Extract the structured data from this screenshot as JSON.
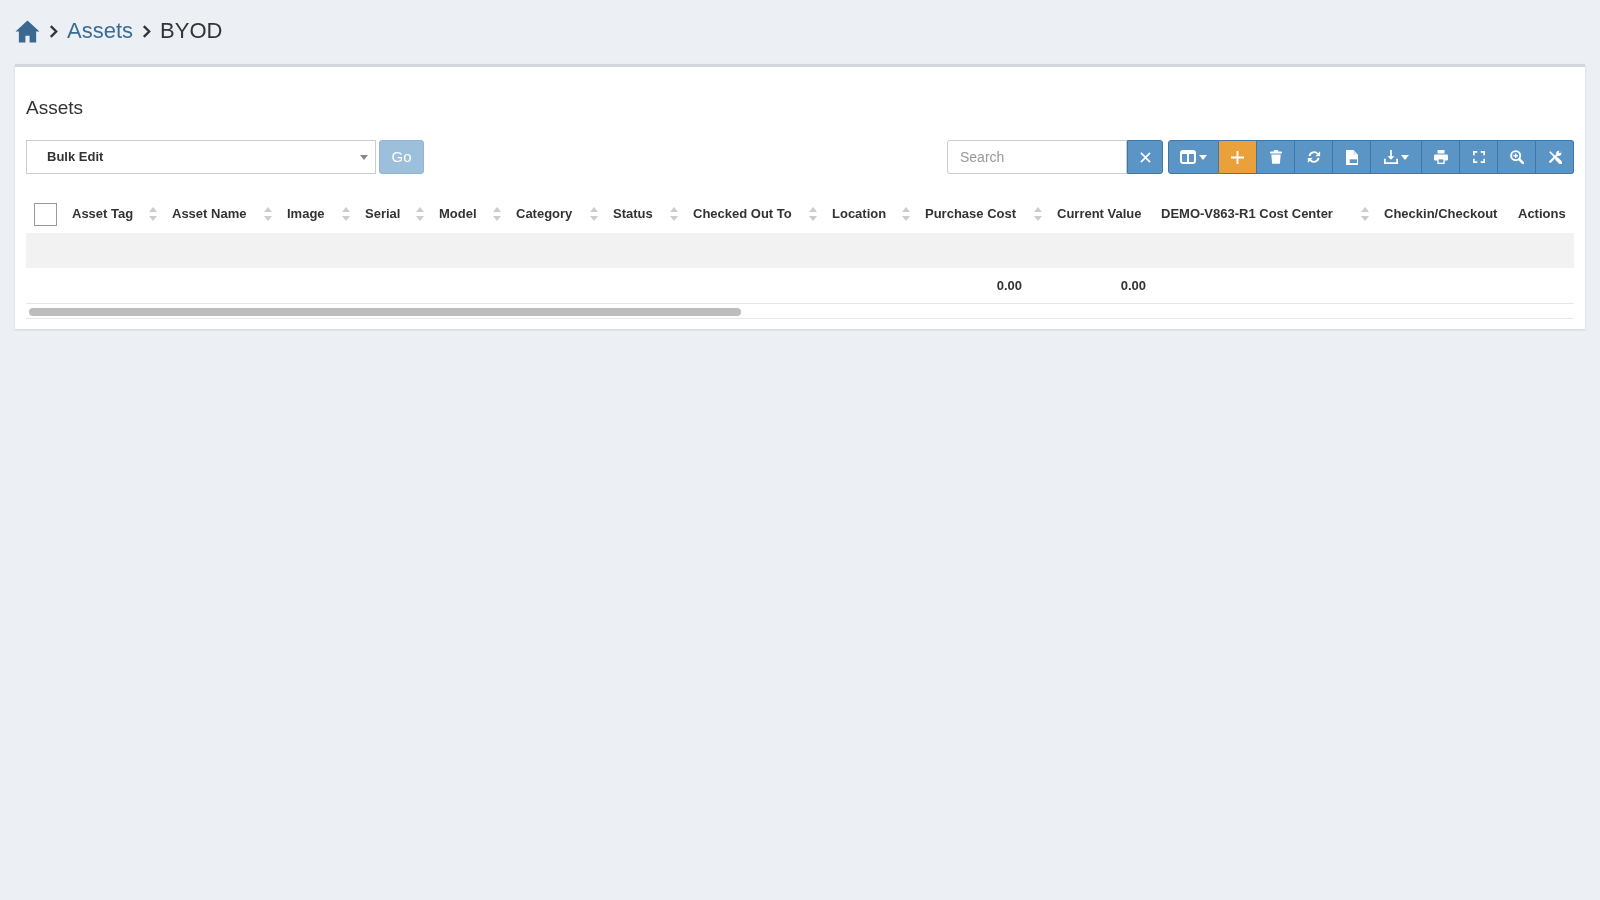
{
  "breadcrumb": [
    {
      "kind": "home"
    },
    {
      "kind": "link",
      "text": "Assets"
    },
    {
      "kind": "current",
      "text": "BYOD"
    }
  ],
  "panel": {
    "title": "Assets"
  },
  "bulk_actions": {
    "value": "Bulk Edit",
    "go_button": {
      "label": "Go",
      "disabled": true
    }
  },
  "search": {
    "placeholder": "Search"
  },
  "toolbar": [
    {
      "kind": "columns",
      "dropdown": true,
      "color": "#5b95c6"
    },
    {
      "kind": "add",
      "dropdown": false,
      "color": "#eaa13a"
    },
    {
      "kind": "delete",
      "dropdown": false,
      "color": "#5b95c6"
    },
    {
      "kind": "refresh",
      "dropdown": false,
      "color": "#5b95c6"
    },
    {
      "kind": "csv",
      "dropdown": false,
      "color": "#5b95c6"
    },
    {
      "kind": "export",
      "dropdown": true,
      "color": "#5b95c6"
    },
    {
      "kind": "print",
      "dropdown": false,
      "color": "#5b95c6"
    },
    {
      "kind": "fullscreen",
      "dropdown": false,
      "color": "#5b95c6"
    },
    {
      "kind": "zoom",
      "dropdown": false,
      "color": "#5b95c6"
    },
    {
      "kind": "tools",
      "dropdown": false,
      "color": "#5b95c6"
    }
  ],
  "table": {
    "select_all": {
      "checked": false
    },
    "columns": [
      {
        "label": "Asset Tag",
        "sortable": true
      },
      {
        "label": "Asset Name",
        "sortable": true
      },
      {
        "label": "Image",
        "sortable": true
      },
      {
        "label": "Serial",
        "sortable": true
      },
      {
        "label": "Model",
        "sortable": true
      },
      {
        "label": "Category",
        "sortable": true
      },
      {
        "label": "Status",
        "sortable": true
      },
      {
        "label": "Checked Out To",
        "sortable": true
      },
      {
        "label": "Location",
        "sortable": true
      },
      {
        "label": "Purchase Cost",
        "sortable": true,
        "footer": "0.00"
      },
      {
        "label": "Current Value",
        "sortable": false,
        "footer": "0.00"
      },
      {
        "label": "DEMO-V863-R1 Cost Center",
        "sortable": true
      },
      {
        "label": "Checkin/Checkout",
        "sortable": false
      },
      {
        "label": "Actions",
        "sortable": false
      }
    ]
  }
}
